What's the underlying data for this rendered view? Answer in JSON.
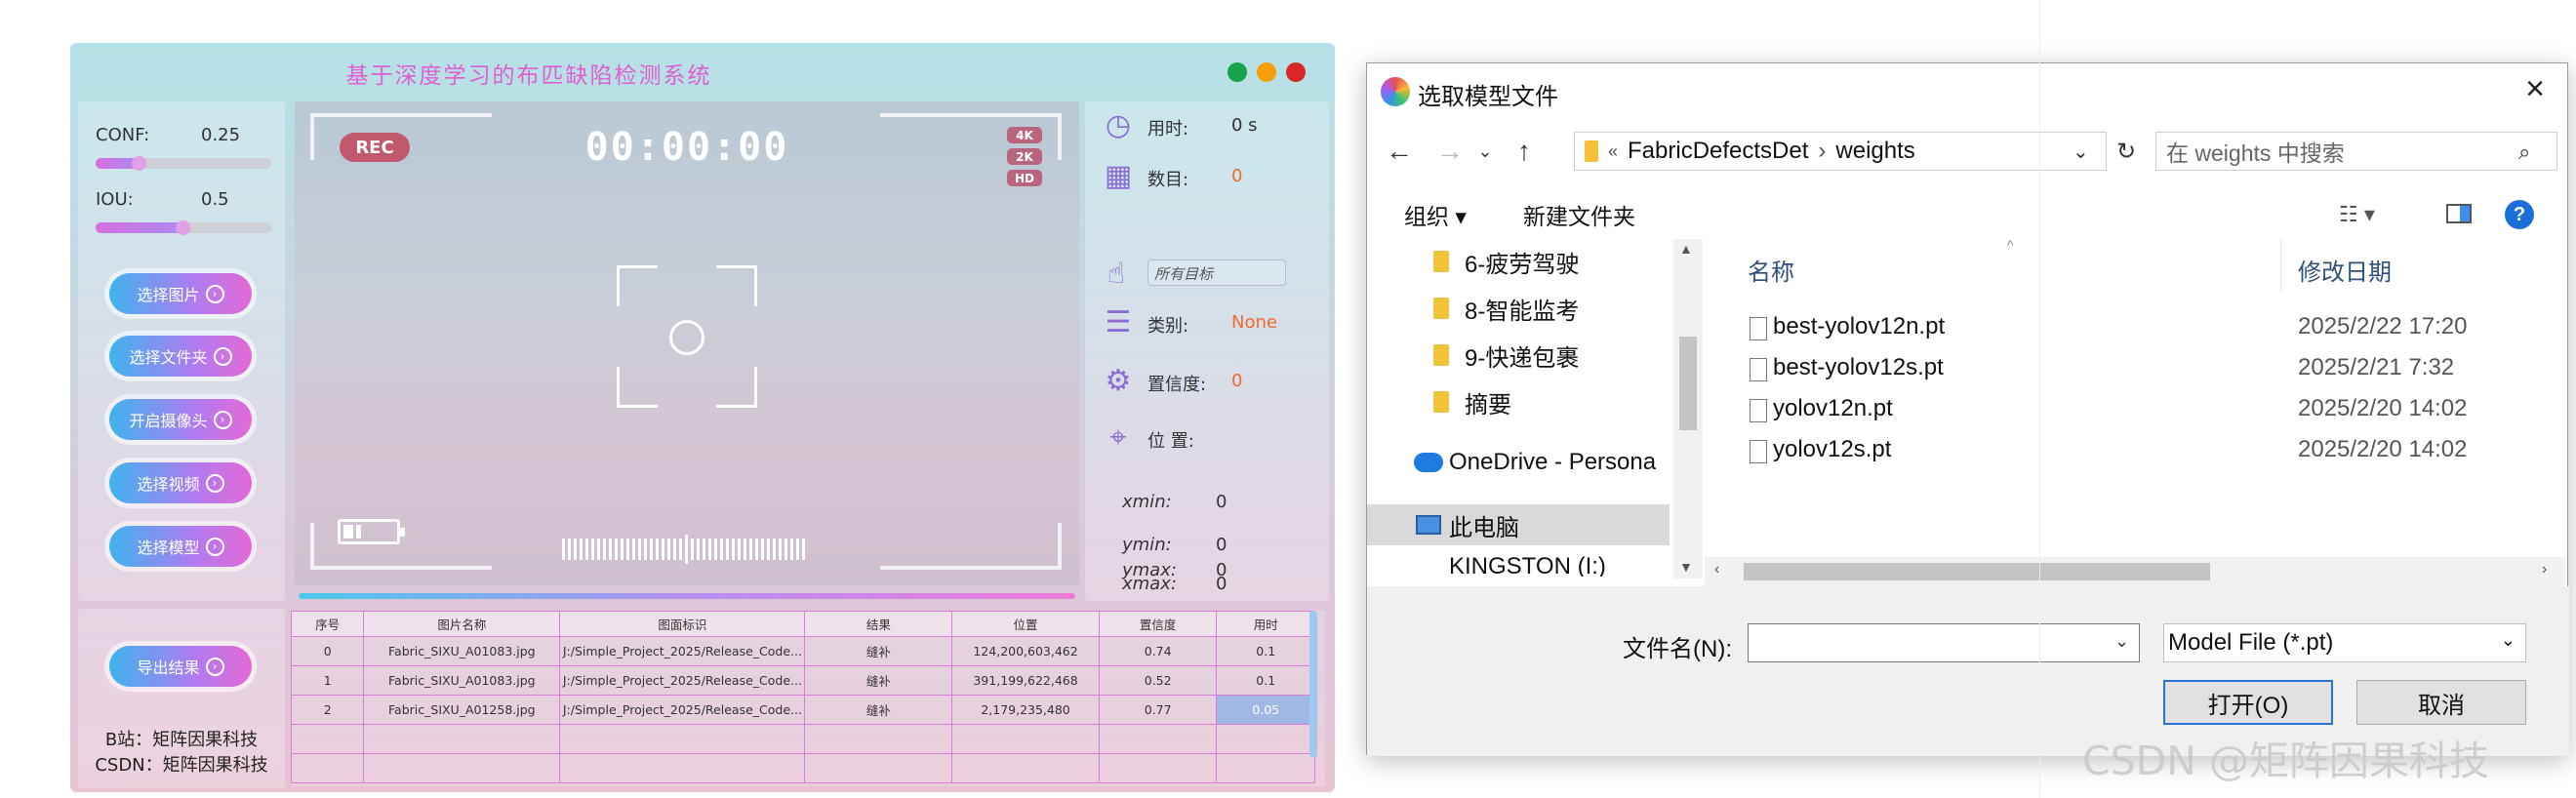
{
  "app": {
    "title": "基于深度学习的布匹缺陷检测系统",
    "window_dots": [
      "#16a34a",
      "#f59e0b",
      "#dc2626"
    ],
    "conf_label": "CONF:",
    "conf_value": "0.25",
    "conf_level": 0.25,
    "iou_label": "IOU:",
    "iou_value": "0.5",
    "iou_level": 0.5,
    "buttons": [
      "选择图片",
      "选择文件夹",
      "开启摄像头",
      "选择视频",
      "选择模型"
    ],
    "export_button": "导出结果",
    "credits": [
      "B站：矩阵因果科技",
      "CSDN：矩阵因果科技"
    ],
    "viewer": {
      "rec": "REC",
      "timer": "00:00:00",
      "tags": [
        "4K",
        "2K",
        "HD"
      ]
    },
    "info": {
      "time_label": "用时:",
      "time_value": "0 s",
      "count_label": "数目:",
      "count_value": "0",
      "target_placeholder": "所有目标",
      "class_label": "类别:",
      "class_value": "None",
      "conf_label": "置信度:",
      "conf_value": "0",
      "pos_label": "位 置:",
      "coords": [
        {
          "label": "xmin:",
          "value": "0"
        },
        {
          "label": "ymin:",
          "value": "0"
        },
        {
          "label": "xmax:",
          "value": "0"
        },
        {
          "label": "ymax:",
          "value": "0"
        }
      ],
      "value_color": "#f06a2c"
    },
    "table": {
      "headers": [
        "序号",
        "图片名称",
        "图面标识",
        "结果",
        "位置",
        "置信度",
        "用时"
      ],
      "rows": [
        [
          "0",
          "Fabric_SIXU_A01083.jpg",
          "J:/Simple_Project_2025/Release_Code...",
          "缝补",
          "124,200,603,462",
          "0.74",
          "0.1"
        ],
        [
          "1",
          "Fabric_SIXU_A01083.jpg",
          "J:/Simple_Project_2025/Release_Code...",
          "缝补",
          "391,199,622,468",
          "0.52",
          "0.1"
        ],
        [
          "2",
          "Fabric_SIXU_A01258.jpg",
          "J:/Simple_Project_2025/Release_Code...",
          "缝补",
          "2,179,235,480",
          "0.77",
          "0.05"
        ]
      ]
    }
  },
  "dialog": {
    "title": "选取模型文件",
    "close_icon": "×",
    "path": [
      "«",
      "FabricDefectsDet",
      "›",
      "weights"
    ],
    "search_placeholder": "在 weights 中搜索",
    "toolbar": {
      "organize": "组织 ▾",
      "new_folder": "新建文件夹"
    },
    "nav_items": [
      {
        "label": "6-疲劳驾驶",
        "icon": "folder-icon"
      },
      {
        "label": "8-智能监考",
        "icon": "folder-icon"
      },
      {
        "label": "9-快递包裹",
        "icon": "folder-icon"
      },
      {
        "label": "摘要",
        "icon": "folder-icon"
      },
      {
        "label": "OneDrive - Persona",
        "icon": "onedrive-icon"
      },
      {
        "label": "此电脑",
        "icon": "computer-icon"
      },
      {
        "label": "KINGSTON (I:)",
        "icon": "drive-icon"
      }
    ],
    "columns": {
      "name": "名称",
      "modified": "修改日期"
    },
    "files": [
      {
        "name": "best-yolov12n.pt",
        "date": "2025/2/22 17:20"
      },
      {
        "name": "best-yolov12s.pt",
        "date": "2025/2/21 7:32"
      },
      {
        "name": "yolov12n.pt",
        "date": "2025/2/20 14:02"
      },
      {
        "name": "yolov12s.pt",
        "date": "2025/2/20 14:02"
      }
    ],
    "filename_label": "文件名(N):",
    "filename_value": "",
    "filetype": "Model File (*.pt)",
    "open_button": "打开(O)",
    "cancel_button": "取消"
  },
  "watermark": "CSDN @矩阵因果科技"
}
